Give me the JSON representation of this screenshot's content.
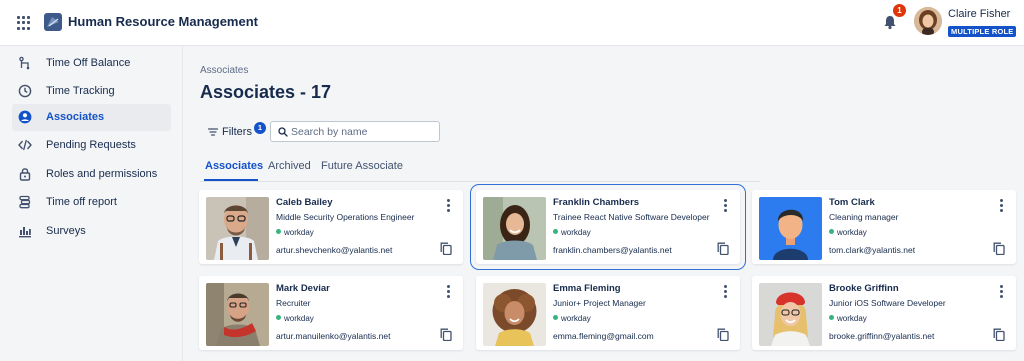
{
  "app": {
    "title": "Human Resource Management",
    "logo_icon": "hr-logo-icon",
    "apps_icon": "apps-grid-icon"
  },
  "header": {
    "notification_count": "1",
    "user_name": "Claire Fisher",
    "role_badge": "MULTIPLE ROLE",
    "accent": "#1452c9",
    "alert_color": "#de350b"
  },
  "sidebar": {
    "items": [
      {
        "label": "Time Off Balance",
        "icon": "time-off-balance-icon",
        "active": false
      },
      {
        "label": "Time Tracking",
        "icon": "clock-icon",
        "active": false
      },
      {
        "label": "Associates",
        "icon": "person-icon",
        "active": true
      },
      {
        "label": "Pending Requests",
        "icon": "code-icon",
        "active": false
      },
      {
        "label": "Roles and permissions",
        "icon": "lock-icon",
        "active": false
      },
      {
        "label": "Time off report",
        "icon": "report-icon",
        "active": false
      },
      {
        "label": "Surveys",
        "icon": "bar-chart-icon",
        "active": false
      }
    ]
  },
  "main": {
    "breadcrumb": "Associates",
    "title": "Associates - 17",
    "filters_label": "Filters",
    "filters_count": "1",
    "search_placeholder": "Search by name",
    "tabs": [
      {
        "label": "Associates",
        "active": true
      },
      {
        "label": "Archived",
        "active": false
      },
      {
        "label": "Future Associate",
        "active": false
      }
    ]
  },
  "associates": [
    {
      "name": "Caleb Bailey",
      "role": "Middle Security Operations Engineer",
      "status": "workday",
      "email": "artur.shevchenko@yalantis.net",
      "selected": false
    },
    {
      "name": "Franklin Chambers",
      "role": "Trainee React Native Software Developer",
      "status": "workday",
      "email": "franklin.chambers@yalantis.net",
      "selected": true
    },
    {
      "name": "Tom Clark",
      "role": "Cleaning manager",
      "status": "workday",
      "email": "tom.clark@yalantis.net",
      "selected": false
    },
    {
      "name": "Mark Deviar",
      "role": "Recruiter",
      "status": "workday",
      "email": "artur.manuilenko@yalantis.net",
      "selected": false
    },
    {
      "name": "Emma Fleming",
      "role": "Junior+ Project Manager",
      "status": "workday",
      "email": "emma.fleming@gmail.com",
      "selected": false
    },
    {
      "name": "Brooke Griffinn",
      "role": "Junior iOS Software Developer",
      "status": "workday",
      "email": "brooke.griffinn@yalantis.net",
      "selected": false
    }
  ]
}
